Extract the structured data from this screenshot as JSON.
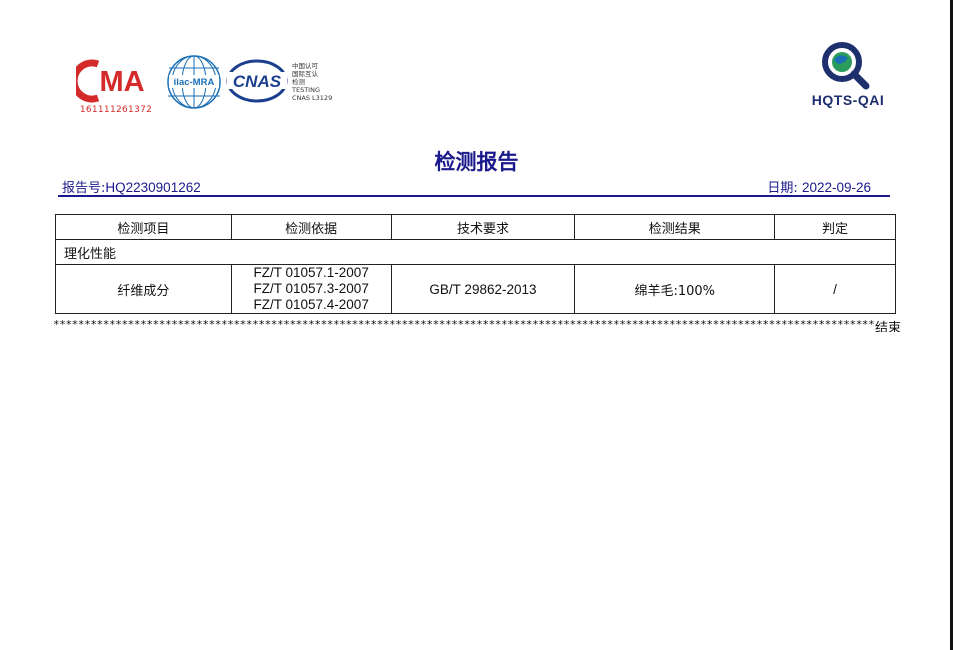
{
  "logos": {
    "cma_text": "MA",
    "cma_number": "161111261372",
    "ilac_text": "ilac-MRA",
    "cnas_text": "CNAS",
    "cnas_side_lines": [
      "中国认可",
      "国际互认",
      "检测",
      "TESTING",
      "CNAS L3129"
    ],
    "hqts_label": "HQTS-QAI"
  },
  "report": {
    "title": "检测报告",
    "number_label": "报告号:",
    "number": "HQ2230901262",
    "date_label": "日期:",
    "date": "2022-09-26"
  },
  "table": {
    "headers": [
      "检测项目",
      "检测依据",
      "技术要求",
      "检测结果",
      "判定"
    ],
    "section": "理化性能",
    "row": {
      "item": "纤维成分",
      "basis": [
        "FZ/T 01057.1-2007",
        "FZ/T 01057.3-2007",
        "FZ/T 01057.4-2007"
      ],
      "requirement": "GB/T 29862-2013",
      "result": "绵羊毛:100%",
      "verdict": "/"
    }
  },
  "end_mark": "结束",
  "colors": {
    "title_blue": "#1a1a8c",
    "cma_red": "#d42a2a",
    "hqts_navy": "#1e2f6e",
    "cnas_blue": "#1b3f8f"
  }
}
